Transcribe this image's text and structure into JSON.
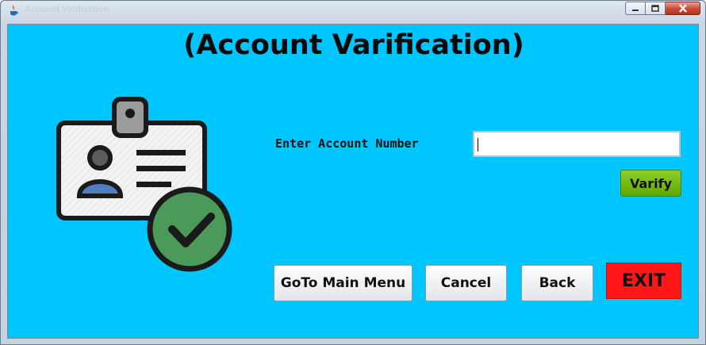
{
  "window": {
    "title": "Account Varification"
  },
  "page": {
    "heading": "(Account Varification)"
  },
  "form": {
    "account_label": "Enter Account Number",
    "account_value": "",
    "verify_label": "Varify"
  },
  "buttons": {
    "main_menu": "GoTo Main Menu",
    "cancel": "Cancel",
    "back": "Back",
    "exit": "EXIT"
  },
  "icons": {
    "app": "java-icon",
    "illustration": "id-card-verified-icon",
    "minimize": "minimize-icon",
    "maximize": "maximize-icon",
    "close": "close-icon"
  },
  "colors": {
    "background": "#00c6ff",
    "verify_button": "#6bb800",
    "exit_button": "#ff1616",
    "check_circle": "#4b9a5a"
  }
}
